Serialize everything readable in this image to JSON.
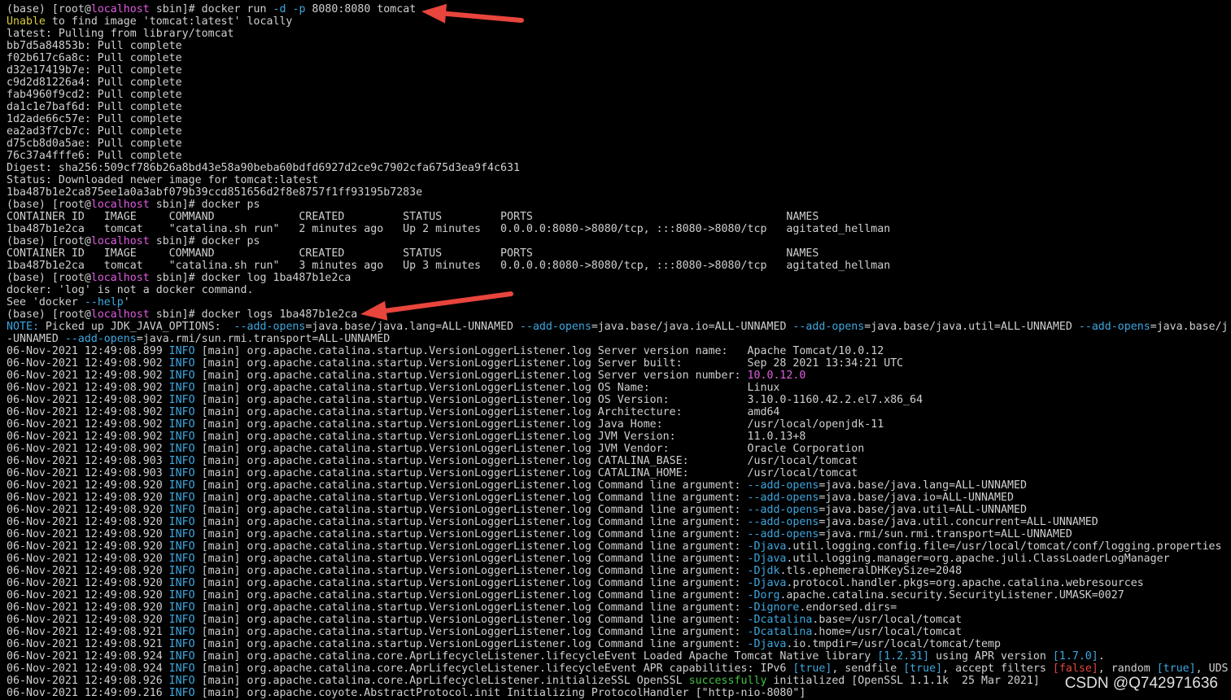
{
  "colors": {
    "background": "#000000",
    "default": "#d0d0d0",
    "host": "#e05ce0",
    "blue": "#3ea8e0",
    "yellow": "#d8cc3c",
    "red": "#e2473d",
    "green": "#3fc23f",
    "arrow": "#e8453c"
  },
  "watermark": "CSDN @Q742971636",
  "terminal": {
    "lines": [
      [
        {
          "t": "(base) [root@"
        },
        {
          "t": "localhost",
          "c": "host"
        },
        {
          "t": " sbin]# docker run "
        },
        {
          "t": "-d",
          "c": "blue"
        },
        {
          "t": " "
        },
        {
          "t": "-p",
          "c": "blue"
        },
        {
          "t": " 8080:8080 tomcat"
        }
      ],
      [
        {
          "t": "Unable",
          "c": "yellow"
        },
        {
          "t": " to find image 'tomcat:latest' locally"
        }
      ],
      [
        {
          "t": "latest: Pulling from library/tomcat"
        }
      ],
      [
        {
          "t": "bb7d5a84853b: Pull complete"
        }
      ],
      [
        {
          "t": "f02b617c6a8c: Pull complete"
        }
      ],
      [
        {
          "t": "d32e17419b7e: Pull complete"
        }
      ],
      [
        {
          "t": "c9d2d81226a4: Pull complete"
        }
      ],
      [
        {
          "t": "fab4960f9cd2: Pull complete"
        }
      ],
      [
        {
          "t": "da1c1e7baf6d: Pull complete"
        }
      ],
      [
        {
          "t": "1d2ade66c57e: Pull complete"
        }
      ],
      [
        {
          "t": "ea2ad3f7cb7c: Pull complete"
        }
      ],
      [
        {
          "t": "d75cb8d0a5ae: Pull complete"
        }
      ],
      [
        {
          "t": "76c37a4fffe6: Pull complete"
        }
      ],
      [
        {
          "t": "Digest: sha256:509cf786b26a8bd43e58a90beba60bdfd6927d2ce9c7902cfa675d3ea9f4c631"
        }
      ],
      [
        {
          "t": "Status: Downloaded newer image for tomcat:latest"
        }
      ],
      [
        {
          "t": "1ba487b1e2ca875ee1a0a3abf079b39ccd851656d2f8e8757f1ff93195b7283e"
        }
      ],
      [
        {
          "t": "(base) [root@"
        },
        {
          "t": "localhost",
          "c": "host"
        },
        {
          "t": " sbin]# docker ps"
        }
      ],
      [
        {
          "t": "CONTAINER ID   IMAGE     COMMAND             CREATED         STATUS         PORTS                                       NAMES"
        }
      ],
      [
        {
          "t": "1ba487b1e2ca   tomcat    \"catalina.sh run\"   2 minutes ago   Up 2 minutes   0.0.0.0:8080->8080/tcp, :::8080->8080/tcp   agitated_hellman"
        }
      ],
      [
        {
          "t": "(base) [root@"
        },
        {
          "t": "localhost",
          "c": "host"
        },
        {
          "t": " sbin]# docker ps"
        }
      ],
      [
        {
          "t": "CONTAINER ID   IMAGE     COMMAND             CREATED         STATUS         PORTS                                       NAMES"
        }
      ],
      [
        {
          "t": "1ba487b1e2ca   tomcat    \"catalina.sh run\"   3 minutes ago   Up 3 minutes   0.0.0.0:8080->8080/tcp, :::8080->8080/tcp   agitated_hellman"
        }
      ],
      [
        {
          "t": "(base) [root@"
        },
        {
          "t": "localhost",
          "c": "host"
        },
        {
          "t": " sbin]# docker log 1ba487b1e2ca"
        }
      ],
      [
        {
          "t": "docker: 'log' is not a docker command."
        }
      ],
      [
        {
          "t": "See 'docker "
        },
        {
          "t": "--help",
          "c": "blue"
        },
        {
          "t": "'"
        }
      ],
      [
        {
          "t": "(base) [root@"
        },
        {
          "t": "localhost",
          "c": "host"
        },
        {
          "t": " sbin]# docker logs 1ba487b1e2ca"
        }
      ],
      [
        {
          "t": "NOTE:",
          "c": "blue"
        },
        {
          "t": " Picked up JDK_JAVA_OPTIONS:  "
        },
        {
          "t": "--add-opens",
          "c": "blue"
        },
        {
          "t": "=java.base/java.lang=ALL-UNNAMED "
        },
        {
          "t": "--add-opens",
          "c": "blue"
        },
        {
          "t": "=java.base/java.io=ALL-UNNAMED "
        },
        {
          "t": "--add-opens",
          "c": "blue"
        },
        {
          "t": "=java.base/java.util=ALL-UNNAMED "
        },
        {
          "t": "--add-opens",
          "c": "blue"
        },
        {
          "t": "=java.base/j"
        }
      ],
      [
        {
          "t": "-UNNAMED "
        },
        {
          "t": "--add-opens",
          "c": "blue"
        },
        {
          "t": "=java.rmi/sun.rmi.transport=ALL-UNNAMED"
        }
      ],
      [
        {
          "t": "06-Nov-2021 12:49:08.899 "
        },
        {
          "t": "INFO",
          "c": "blue"
        },
        {
          "t": " [main] org.apache.catalina.startup.VersionLoggerListener.log Server version name:   Apache Tomcat/10.0.12"
        }
      ],
      [
        {
          "t": "06-Nov-2021 12:49:08.902 "
        },
        {
          "t": "INFO",
          "c": "blue"
        },
        {
          "t": " [main] org.apache.catalina.startup.VersionLoggerListener.log Server built:          Sep 28 2021 13:34:21 UTC"
        }
      ],
      [
        {
          "t": "06-Nov-2021 12:49:08.902 "
        },
        {
          "t": "INFO",
          "c": "blue"
        },
        {
          "t": " [main] org.apache.catalina.startup.VersionLoggerListener.log Server version number: "
        },
        {
          "t": "10.0.12.0",
          "c": "host"
        }
      ],
      [
        {
          "t": "06-Nov-2021 12:49:08.902 "
        },
        {
          "t": "INFO",
          "c": "blue"
        },
        {
          "t": " [main] org.apache.catalina.startup.VersionLoggerListener.log OS Name:               Linux"
        }
      ],
      [
        {
          "t": "06-Nov-2021 12:49:08.902 "
        },
        {
          "t": "INFO",
          "c": "blue"
        },
        {
          "t": " [main] org.apache.catalina.startup.VersionLoggerListener.log OS Version:            3.10.0-1160.42.2.el7.x86_64"
        }
      ],
      [
        {
          "t": "06-Nov-2021 12:49:08.902 "
        },
        {
          "t": "INFO",
          "c": "blue"
        },
        {
          "t": " [main] org.apache.catalina.startup.VersionLoggerListener.log Architecture:          amd64"
        }
      ],
      [
        {
          "t": "06-Nov-2021 12:49:08.902 "
        },
        {
          "t": "INFO",
          "c": "blue"
        },
        {
          "t": " [main] org.apache.catalina.startup.VersionLoggerListener.log Java Home:             /usr/local/openjdk-11"
        }
      ],
      [
        {
          "t": "06-Nov-2021 12:49:08.902 "
        },
        {
          "t": "INFO",
          "c": "blue"
        },
        {
          "t": " [main] org.apache.catalina.startup.VersionLoggerListener.log JVM Version:           11.0.13+8"
        }
      ],
      [
        {
          "t": "06-Nov-2021 12:49:08.902 "
        },
        {
          "t": "INFO",
          "c": "blue"
        },
        {
          "t": " [main] org.apache.catalina.startup.VersionLoggerListener.log JVM Vendor:            Oracle Corporation"
        }
      ],
      [
        {
          "t": "06-Nov-2021 12:49:08.903 "
        },
        {
          "t": "INFO",
          "c": "blue"
        },
        {
          "t": " [main] org.apache.catalina.startup.VersionLoggerListener.log CATALINA_BASE:         /usr/local/tomcat"
        }
      ],
      [
        {
          "t": "06-Nov-2021 12:49:08.903 "
        },
        {
          "t": "INFO",
          "c": "blue"
        },
        {
          "t": " [main] org.apache.catalina.startup.VersionLoggerListener.log CATALINA_HOME:         /usr/local/tomcat"
        }
      ],
      [
        {
          "t": "06-Nov-2021 12:49:08.920 "
        },
        {
          "t": "INFO",
          "c": "blue"
        },
        {
          "t": " [main] org.apache.catalina.startup.VersionLoggerListener.log Command line argument: "
        },
        {
          "t": "--add-opens",
          "c": "blue"
        },
        {
          "t": "=java.base/java.lang=ALL-UNNAMED"
        }
      ],
      [
        {
          "t": "06-Nov-2021 12:49:08.920 "
        },
        {
          "t": "INFO",
          "c": "blue"
        },
        {
          "t": " [main] org.apache.catalina.startup.VersionLoggerListener.log Command line argument: "
        },
        {
          "t": "--add-opens",
          "c": "blue"
        },
        {
          "t": "=java.base/java.io=ALL-UNNAMED"
        }
      ],
      [
        {
          "t": "06-Nov-2021 12:49:08.920 "
        },
        {
          "t": "INFO",
          "c": "blue"
        },
        {
          "t": " [main] org.apache.catalina.startup.VersionLoggerListener.log Command line argument: "
        },
        {
          "t": "--add-opens",
          "c": "blue"
        },
        {
          "t": "=java.base/java.util=ALL-UNNAMED"
        }
      ],
      [
        {
          "t": "06-Nov-2021 12:49:08.920 "
        },
        {
          "t": "INFO",
          "c": "blue"
        },
        {
          "t": " [main] org.apache.catalina.startup.VersionLoggerListener.log Command line argument: "
        },
        {
          "t": "--add-opens",
          "c": "blue"
        },
        {
          "t": "=java.base/java.util.concurrent=ALL-UNNAMED"
        }
      ],
      [
        {
          "t": "06-Nov-2021 12:49:08.920 "
        },
        {
          "t": "INFO",
          "c": "blue"
        },
        {
          "t": " [main] org.apache.catalina.startup.VersionLoggerListener.log Command line argument: "
        },
        {
          "t": "--add-opens",
          "c": "blue"
        },
        {
          "t": "=java.rmi/sun.rmi.transport=ALL-UNNAMED"
        }
      ],
      [
        {
          "t": "06-Nov-2021 12:49:08.920 "
        },
        {
          "t": "INFO",
          "c": "blue"
        },
        {
          "t": " [main] org.apache.catalina.startup.VersionLoggerListener.log Command line argument: "
        },
        {
          "t": "-Djava",
          "c": "blue"
        },
        {
          "t": ".util.logging.config.file=/usr/local/tomcat/conf/logging.properties"
        }
      ],
      [
        {
          "t": "06-Nov-2021 12:49:08.920 "
        },
        {
          "t": "INFO",
          "c": "blue"
        },
        {
          "t": " [main] org.apache.catalina.startup.VersionLoggerListener.log Command line argument: "
        },
        {
          "t": "-Djava",
          "c": "blue"
        },
        {
          "t": ".util.logging.manager=org.apache.juli.ClassLoaderLogManager"
        }
      ],
      [
        {
          "t": "06-Nov-2021 12:49:08.920 "
        },
        {
          "t": "INFO",
          "c": "blue"
        },
        {
          "t": " [main] org.apache.catalina.startup.VersionLoggerListener.log Command line argument: "
        },
        {
          "t": "-Djdk",
          "c": "blue"
        },
        {
          "t": ".tls.ephemeralDHKeySize=2048"
        }
      ],
      [
        {
          "t": "06-Nov-2021 12:49:08.920 "
        },
        {
          "t": "INFO",
          "c": "blue"
        },
        {
          "t": " [main] org.apache.catalina.startup.VersionLoggerListener.log Command line argument: "
        },
        {
          "t": "-Djava",
          "c": "blue"
        },
        {
          "t": ".protocol.handler.pkgs=org.apache.catalina.webresources"
        }
      ],
      [
        {
          "t": "06-Nov-2021 12:49:08.920 "
        },
        {
          "t": "INFO",
          "c": "blue"
        },
        {
          "t": " [main] org.apache.catalina.startup.VersionLoggerListener.log Command line argument: "
        },
        {
          "t": "-Dorg",
          "c": "blue"
        },
        {
          "t": ".apache.catalina.security.SecurityListener.UMASK=0027"
        }
      ],
      [
        {
          "t": "06-Nov-2021 12:49:08.920 "
        },
        {
          "t": "INFO",
          "c": "blue"
        },
        {
          "t": " [main] org.apache.catalina.startup.VersionLoggerListener.log Command line argument: "
        },
        {
          "t": "-Dignore",
          "c": "blue"
        },
        {
          "t": ".endorsed.dirs="
        }
      ],
      [
        {
          "t": "06-Nov-2021 12:49:08.920 "
        },
        {
          "t": "INFO",
          "c": "blue"
        },
        {
          "t": " [main] org.apache.catalina.startup.VersionLoggerListener.log Command line argument: "
        },
        {
          "t": "-Dcatalina",
          "c": "blue"
        },
        {
          "t": ".base=/usr/local/tomcat"
        }
      ],
      [
        {
          "t": "06-Nov-2021 12:49:08.921 "
        },
        {
          "t": "INFO",
          "c": "blue"
        },
        {
          "t": " [main] org.apache.catalina.startup.VersionLoggerListener.log Command line argument: "
        },
        {
          "t": "-Dcatalina",
          "c": "blue"
        },
        {
          "t": ".home=/usr/local/tomcat"
        }
      ],
      [
        {
          "t": "06-Nov-2021 12:49:08.921 "
        },
        {
          "t": "INFO",
          "c": "blue"
        },
        {
          "t": " [main] org.apache.catalina.startup.VersionLoggerListener.log Command line argument: "
        },
        {
          "t": "-Djava",
          "c": "blue"
        },
        {
          "t": ".io.tmpdir=/usr/local/tomcat/temp"
        }
      ],
      [
        {
          "t": "06-Nov-2021 12:49:08.924 "
        },
        {
          "t": "INFO",
          "c": "blue"
        },
        {
          "t": " [main] org.apache.catalina.core.AprLifecycleListener.lifecycleEvent Loaded Apache Tomcat Native library "
        },
        {
          "t": "[1.2.31]",
          "c": "blue"
        },
        {
          "t": " using APR version "
        },
        {
          "t": "[1.7.0]",
          "c": "blue"
        },
        {
          "t": "."
        }
      ],
      [
        {
          "t": "06-Nov-2021 12:49:08.924 "
        },
        {
          "t": "INFO",
          "c": "blue"
        },
        {
          "t": " [main] org.apache.catalina.core.AprLifecycleListener.lifecycleEvent APR capabilities: IPv6 "
        },
        {
          "t": "[true]",
          "c": "blue"
        },
        {
          "t": ", sendfile "
        },
        {
          "t": "[true]",
          "c": "blue"
        },
        {
          "t": ", accept filters "
        },
        {
          "t": "[false]",
          "c": "red"
        },
        {
          "t": ", random "
        },
        {
          "t": "[true]",
          "c": "blue"
        },
        {
          "t": ", UDS"
        }
      ],
      [
        {
          "t": "06-Nov-2021 12:49:08.926 "
        },
        {
          "t": "INFO",
          "c": "blue"
        },
        {
          "t": " [main] org.apache.catalina.core.AprLifecycleListener.initializeSSL OpenSSL "
        },
        {
          "t": "successfully",
          "c": "green"
        },
        {
          "t": " initialized [OpenSSL 1.1.1k  25 Mar 2021]"
        }
      ],
      [
        {
          "t": "06-Nov-2021 12:49:09.216 "
        },
        {
          "t": "INFO",
          "c": "blue"
        },
        {
          "t": " [main] org.apache.coyote.AbstractProtocol.init Initializing ProtocolHandler [\"http-nio-8080\"]"
        }
      ]
    ]
  }
}
